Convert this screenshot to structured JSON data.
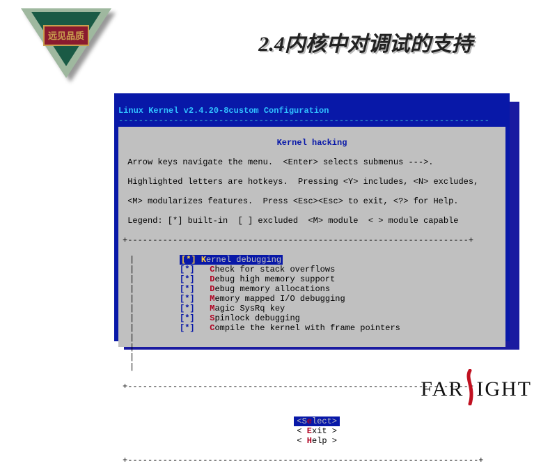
{
  "badge_text": "远见品质",
  "slide_title": "2.4内核中对调试的支持",
  "terminal": {
    "title": "Linux Kernel v2.4.20-8custom Configuration",
    "section": "Kernel hacking",
    "help1": " Arrow keys navigate the menu.  <Enter> selects submenus --->.",
    "help2": " Highlighted letters are hotkeys.  Pressing <Y> includes, <N> excludes,",
    "help3": " <M> modularizes features.  Press <Esc><Esc> to exit, <?> for Help.",
    "help4": " Legend: [*] built-in  [ ] excluded  <M> module  < > module capable",
    "menu": [
      {
        "mark": "[*]",
        "hot": "K",
        "rest": "ernel debugging",
        "indent": 1,
        "selected": true
      },
      {
        "mark": "[*]",
        "hot": "C",
        "rest": "heck for stack overflows",
        "indent": 3
      },
      {
        "mark": "[*]",
        "hot": "D",
        "rest": "ebug high memory support",
        "indent": 3
      },
      {
        "mark": "[*]",
        "hot": "D",
        "rest": "ebug memory allocations",
        "indent": 3
      },
      {
        "mark": "[*]",
        "hot": "M",
        "rest": "emory mapped I/O debugging",
        "indent": 3
      },
      {
        "mark": "[*]",
        "hot": "M",
        "rest": "agic SysRq key",
        "indent": 3
      },
      {
        "mark": "[*]",
        "hot": "S",
        "rest": "pinlock debugging",
        "indent": 3
      },
      {
        "mark": "[*]",
        "hot": "C",
        "rest": "ompile the kernel with frame pointers",
        "indent": 3
      }
    ],
    "buttons": {
      "select": {
        "pre": "<S",
        "hot": "e",
        "post": "lect>",
        "selected": true
      },
      "exit": {
        "pre": "< ",
        "hot": "E",
        "post": "xit >"
      },
      "help": {
        "pre": "< ",
        "hot": "H",
        "post": "elp >"
      }
    }
  },
  "logo": {
    "left": "FAR",
    "right": "IGHT"
  }
}
